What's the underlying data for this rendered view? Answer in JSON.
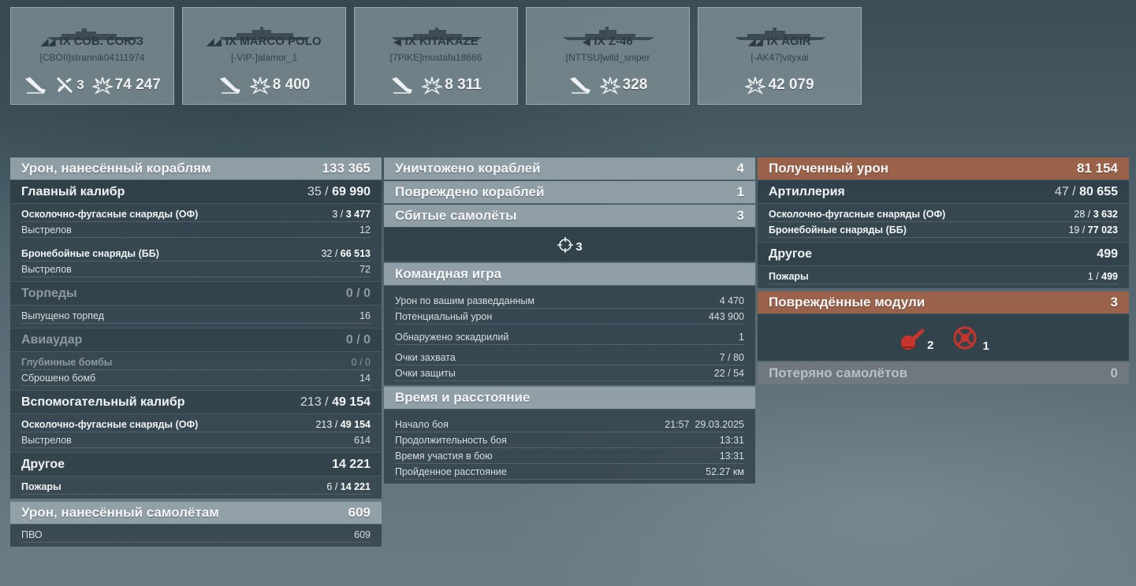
{
  "cards": [
    {
      "cls": "IX",
      "name": "СОВ. СОЮЗ",
      "player": "[CBOII]strannik04111974",
      "stats": [
        {
          "icon": "torpedo-hit-icon",
          "value": ""
        },
        {
          "icon": "plane-downed-icon",
          "value": "3"
        },
        {
          "icon": "damage-burst-icon",
          "value": "74 247"
        }
      ]
    },
    {
      "cls": "IX",
      "name": "MARCO POLO",
      "player": "[-VIP-]alamor_1",
      "stats": [
        {
          "icon": "torpedo-hit-icon",
          "value": ""
        },
        {
          "icon": "damage-burst-icon",
          "value": "8 400"
        }
      ]
    },
    {
      "cls": "IX",
      "name": "KITAKAZE",
      "player": "[7PIKE]mustafa18686",
      "stats": [
        {
          "icon": "torpedo-hit-icon",
          "value": ""
        },
        {
          "icon": "damage-burst-icon",
          "value": "8 311"
        }
      ]
    },
    {
      "cls": "IX",
      "name": "Z-46",
      "player": "[NTTSU]wild_sniper",
      "stats": [
        {
          "icon": "torpedo-hit-icon",
          "value": ""
        },
        {
          "icon": "damage-burst-icon",
          "value": "328"
        }
      ]
    },
    {
      "cls": "IX",
      "name": "ÄGIR",
      "player": "[-AK47]vityxai",
      "stats": [
        {
          "icon": "damage-burst-icon",
          "value": "42 079"
        }
      ]
    }
  ],
  "col1": {
    "ship_damage": {
      "label": "Урон, нанесённый кораблям",
      "value": "133 365"
    },
    "main": {
      "label": "Главный калибр",
      "hits": "35",
      "value": "69 990"
    },
    "main_he": {
      "label": "Осколочно-фугасные снаряды (ОФ)",
      "hits": "3",
      "value": "3 477"
    },
    "main_he_shots": {
      "label": "Выстрелов",
      "value": "12"
    },
    "main_ap": {
      "label": "Бронебойные снаряды (ББ)",
      "hits": "32",
      "value": "66 513"
    },
    "main_ap_shots": {
      "label": "Выстрелов",
      "value": "72"
    },
    "torp": {
      "label": "Торпеды",
      "value": "0 / 0"
    },
    "torp_fired": {
      "label": "Выпущено торпед",
      "value": "16"
    },
    "air": {
      "label": "Авиаудар",
      "value": "0 / 0"
    },
    "depth": {
      "label": "Глубинные бомбы",
      "value": "0 / 0"
    },
    "bombs": {
      "label": "Сброшено бомб",
      "value": "14"
    },
    "sec": {
      "label": "Вспомогательный калибр",
      "hits": "213",
      "value": "49 154"
    },
    "sec_he": {
      "label": "Осколочно-фугасные снаряды (ОФ)",
      "hits": "213",
      "value": "49 154"
    },
    "sec_shots": {
      "label": "Выстрелов",
      "value": "614"
    },
    "other": {
      "label": "Другое",
      "value": "14 221"
    },
    "fires": {
      "label": "Пожары",
      "hits": "6",
      "value": "14 221"
    },
    "plane_damage": {
      "label": "Урон, нанесённый самолётам",
      "value": "609"
    },
    "aa": {
      "label": "ПВО",
      "value": "609"
    }
  },
  "col2": {
    "destroyed": {
      "label": "Уничтожено кораблей",
      "value": "4"
    },
    "damaged": {
      "label": "Повреждено кораблей",
      "value": "1"
    },
    "planes": {
      "label": "Сбитые самолёты",
      "value": "3"
    },
    "planes_icon_value": "3",
    "team": {
      "label": "Командная игра"
    },
    "spot_dmg": {
      "label": "Урон по вашим разведданным",
      "value": "4 470"
    },
    "potential": {
      "label": "Потенциальный урон",
      "value": "443 900"
    },
    "squadrons": {
      "label": "Обнаружено эскадрилий",
      "value": "1"
    },
    "capture": {
      "label": "Очки захвата",
      "value": "7 / 80"
    },
    "defense": {
      "label": "Очки защиты",
      "value": "22 / 54"
    },
    "time": {
      "label": "Время и расстояние"
    },
    "start": {
      "label": "Начало боя",
      "value": "21:57  29.03.2025"
    },
    "duration": {
      "label": "Продолжительность боя",
      "value": "13:31"
    },
    "participation": {
      "label": "Время участия в бою",
      "value": "13:31"
    },
    "distance": {
      "label": "Пройденное расстояние",
      "value": "52.27 км"
    }
  },
  "col3": {
    "received": {
      "label": "Полученный урон",
      "value": "81 154"
    },
    "artillery": {
      "label": "Артиллерия",
      "hits": "47",
      "value": "80 655"
    },
    "rec_he": {
      "label": "Осколочно-фугасные снаряды (ОФ)",
      "hits": "28",
      "value": "3 632"
    },
    "rec_ap": {
      "label": "Бронебойные снаряды (ББ)",
      "hits": "19",
      "value": "77 023"
    },
    "other": {
      "label": "Другое",
      "value": "499"
    },
    "fires": {
      "label": "Пожары",
      "hits": "1",
      "value": "499"
    },
    "modules": {
      "label": "Повреждённые модули",
      "value": "3"
    },
    "module_icons": [
      {
        "icon": "main-battery-module-icon",
        "value": "2"
      },
      {
        "icon": "steering-module-icon",
        "value": "1"
      }
    ],
    "lost_planes": {
      "label": "Потеряно самолётов",
      "value": "0"
    }
  },
  "colors": {
    "accent_orange": "#9e6248",
    "module_red": "#c8332b"
  }
}
